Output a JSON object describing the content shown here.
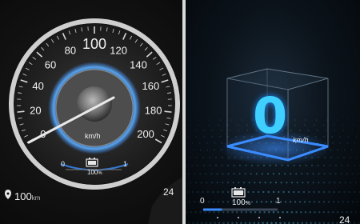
{
  "speedometer": {
    "labels": [
      "0",
      "20",
      "40",
      "60",
      "80",
      "100",
      "120",
      "140",
      "160",
      "180",
      "200"
    ],
    "unit": "km/h",
    "speed": 0,
    "battery_scale_min": "0",
    "battery_scale_max": "1",
    "battery_percent": "100",
    "percent_sign": "%"
  },
  "status": {
    "range_value": "100",
    "range_unit": "km",
    "temperature_left": "24"
  },
  "eco_display": {
    "speed_value": "0",
    "unit": "km/h",
    "battery_scale_min": "0",
    "battery_scale_max": "1",
    "battery_percent": "100",
    "percent_sign": "%",
    "battery_level": 0.25,
    "temperature_right": "24"
  },
  "colors": {
    "accent_blue": "#3a8cff",
    "digit_cyan": "#3fd0ff",
    "bezel": "#cfcfcf"
  },
  "icons": [
    "battery-icon",
    "pin-icon"
  ]
}
